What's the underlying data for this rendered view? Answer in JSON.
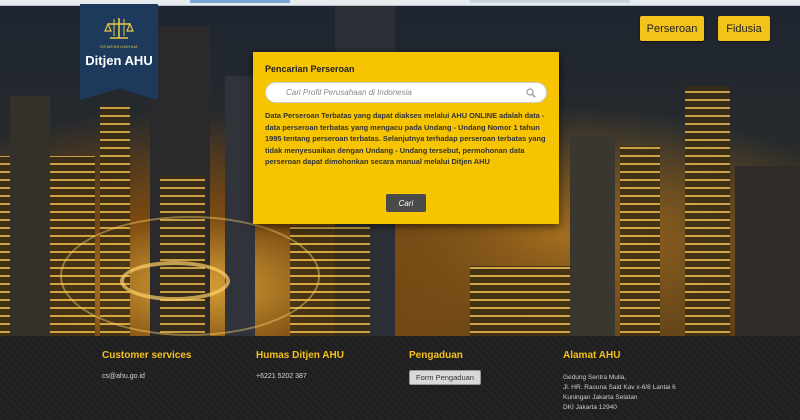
{
  "logo": {
    "subtext": "KEMENKUMHAM",
    "title": "Ditjen AHU"
  },
  "nav": {
    "perseroan": "Perseroan",
    "fidusia": "Fidusia"
  },
  "search_panel": {
    "title": "Pencarian Perseroan",
    "placeholder": "Cari Profil Perusahaan di Indonesia",
    "value": "",
    "description": "Data Perseroan Terbatas yang dapat diakses melalui AHU ONLINE adalah data - data perseroan terbatas yang mengacu pada Undang - Undang Nomor 1 tahun 1995 tentang perseroan terbatas. Selanjutnya terhadap perseroan terbatas yang tidak menyesuaikan dengan Undang - Undang tersebut, permohonan data perseroan dapat dimohonkan secara manual melalui Ditjen AHU",
    "button": "Cari"
  },
  "footer": {
    "customer": {
      "title": "Customer services",
      "email": "cs@ahu.go.id"
    },
    "humas": {
      "title": "Humas Ditjen AHU",
      "phone": "+6221 5202 387"
    },
    "pengaduan": {
      "title": "Pengaduan",
      "button": "Form Pengaduan"
    },
    "alamat": {
      "title": "Alamat AHU",
      "line1": "Gedung Sentra Mulia,",
      "line2": "Jl. HR. Rasuna Said Kav x-6/8 Lantai 6",
      "line3": "Kuningan Jakarta Selatan",
      "line4": "DKI Jakarta 12940"
    }
  },
  "colors": {
    "accent": "#f3c21b",
    "panel": "#f6c400",
    "logo_bg": "#1d3a5c",
    "footer_bg": "#1f1f1f"
  },
  "icons": {
    "emblem": "scales-emblem-icon",
    "search": "magnifier-icon"
  }
}
